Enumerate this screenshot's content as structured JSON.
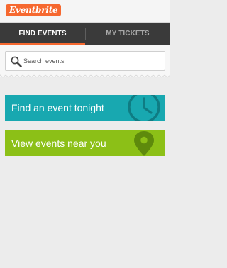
{
  "app": {
    "logo_text": "Eventbrite",
    "brand_color": "#f6682f"
  },
  "tabs": [
    {
      "label": "FIND EVENTS",
      "active": true
    },
    {
      "label": "MY TICKETS",
      "active": false
    }
  ],
  "search": {
    "placeholder": "Search events",
    "value": "",
    "icon": "search-icon"
  },
  "actions": [
    {
      "label": "Find an event tonight",
      "icon": "clock-icon",
      "color": "#18a8b0"
    },
    {
      "label": "View events near you",
      "icon": "map-pin-icon",
      "color": "#8cc017"
    }
  ],
  "colors": {
    "tab_bar": "#3a3a3a",
    "background": "#ececec"
  }
}
